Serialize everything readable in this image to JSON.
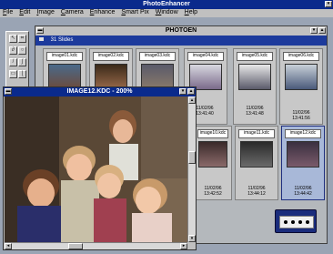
{
  "app": {
    "title": "PhotoEnhancer"
  },
  "menu": [
    "File",
    "Edit",
    "Image",
    "Camera",
    "Enhance",
    "Smart Pix",
    "Window",
    "Help"
  ],
  "browser": {
    "title": "PHOTOEN",
    "count_label": "31 Slides"
  },
  "thumbnails": [
    {
      "label": "image01.kdc",
      "date": "",
      "time": ""
    },
    {
      "label": "image02.kdc",
      "date": "",
      "time": ""
    },
    {
      "label": "image03.kdc",
      "date": "",
      "time": ""
    },
    {
      "label": "image04.kdc",
      "date": "",
      "time": ""
    },
    {
      "label": "image05.kdc",
      "date": "11/02/96",
      "time": "13:41:40"
    },
    {
      "label": "image06.kdc",
      "date": "11/02/96",
      "time": "13:41:56"
    },
    {
      "label": "image04.kdc",
      "date": "11/02/96",
      "time": "13:41:40"
    },
    {
      "label": "image10.kdc",
      "date": "11/02/96",
      "time": "13:42:52"
    },
    {
      "label": "image11.kdc",
      "date": "11/02/96",
      "time": "13:44:12"
    },
    {
      "label": "image12.kdc",
      "date": "11/02/96",
      "time": "13:44:42"
    }
  ],
  "mid_timestamps": {
    "date": "11/02/96",
    "time": "13:41:48"
  },
  "image_window": {
    "title": "IMAGE12.KDC - 200%"
  },
  "tools": [
    "arrow-tool-icon",
    "crop-tool-icon",
    "lasso-tool-icon",
    "zoom-tool-icon",
    "pencil-tool-icon",
    "brush-tool-icon",
    "eraser-tool-icon",
    "dropper-tool-icon"
  ],
  "colors": {
    "titlebar": "#0a2a8c",
    "desktop": "#0c1230",
    "window_gray": "#c0c0c0",
    "selected_thumb": "#a8b8d8"
  }
}
